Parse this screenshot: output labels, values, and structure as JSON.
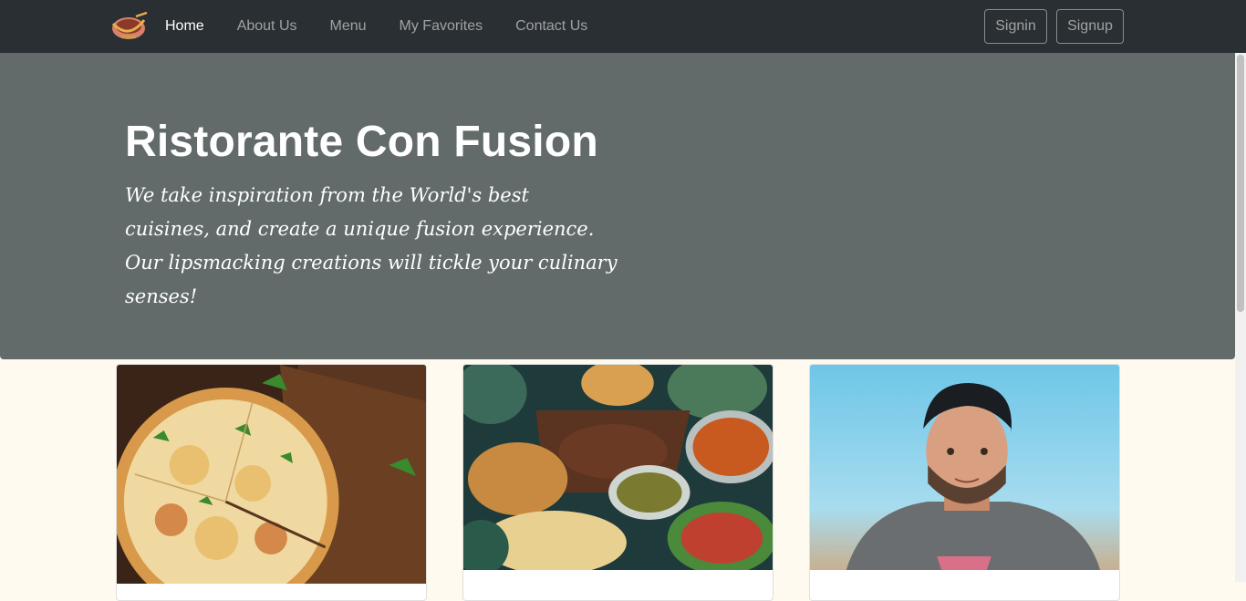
{
  "nav": {
    "brand_alt": "Ristorante Con Fusion",
    "links": [
      {
        "label": "Home",
        "active": true
      },
      {
        "label": "About Us",
        "active": false
      },
      {
        "label": "Menu",
        "active": false
      },
      {
        "label": "My Favorites",
        "active": false
      },
      {
        "label": "Contact Us",
        "active": false
      }
    ],
    "signin_label": "Signin",
    "signup_label": "Signup"
  },
  "hero": {
    "title": "Ristorante Con Fusion",
    "tagline": "We take inspiration from the World's best cuisines, and create a unique fusion experience. Our lipsmacking creations will tickle your culinary senses!"
  },
  "cards": [
    {
      "image": "pizza-photo"
    },
    {
      "image": "dishes-table-photo"
    },
    {
      "image": "chef-portrait-photo"
    }
  ],
  "colors": {
    "navbar": "#292f33",
    "jumbotron": "#626a6a",
    "page_background": "#fffaf0"
  }
}
